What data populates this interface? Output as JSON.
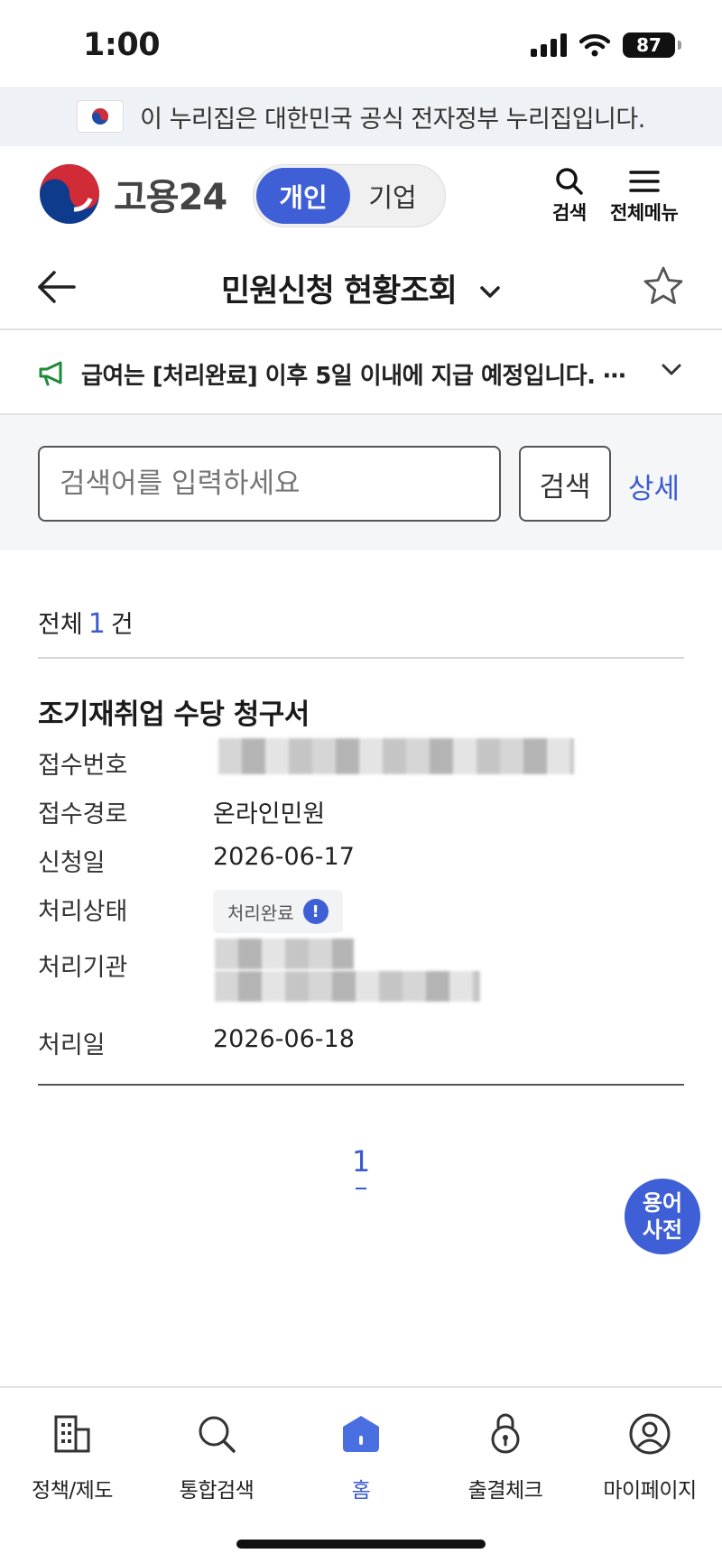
{
  "status_bar": {
    "time": "1:00",
    "battery": "87"
  },
  "gov_banner": {
    "text": "이 누리집은 대한민국 공식 전자정부 누리집입니다."
  },
  "header": {
    "logo_text": "고용24",
    "toggle": {
      "personal": "개인",
      "business": "기업"
    },
    "search_label": "검색",
    "menu_label": "전체메뉴"
  },
  "page": {
    "title": "민원신청 현황조회"
  },
  "notice": {
    "text": "급여는 [처리완료] 이후 5일 이내에 지급 예정입니다. ⋯"
  },
  "search": {
    "placeholder": "검색어를 입력하세요",
    "button": "검색",
    "detail": "상세"
  },
  "results": {
    "total_prefix": "전체",
    "total_count": "1",
    "total_suffix": "건",
    "item": {
      "title": "조기재취업 수당 청구서",
      "labels": {
        "receipt_no": "접수번호",
        "channel": "접수경로",
        "apply_date": "신청일",
        "status": "처리상태",
        "agency": "처리기관",
        "process_date": "처리일"
      },
      "values": {
        "channel": "온라인민원",
        "apply_date": "2026-06-17",
        "status": "처리완료",
        "process_date": "2026-06-18"
      }
    }
  },
  "pagination": {
    "current": "1"
  },
  "fab": {
    "label_line1": "용어",
    "label_line2": "사전"
  },
  "tabbar": {
    "items": [
      {
        "label": "정책/제도",
        "icon": "building-icon"
      },
      {
        "label": "통합검색",
        "icon": "search-icon"
      },
      {
        "label": "홈",
        "icon": "home-icon"
      },
      {
        "label": "출결체크",
        "icon": "lock-icon"
      },
      {
        "label": "마이페이지",
        "icon": "user-icon"
      }
    ]
  },
  "colors": {
    "primary": "#3f5fd6",
    "link": "#3a5bd0",
    "banner_bg": "#eef1f5"
  }
}
